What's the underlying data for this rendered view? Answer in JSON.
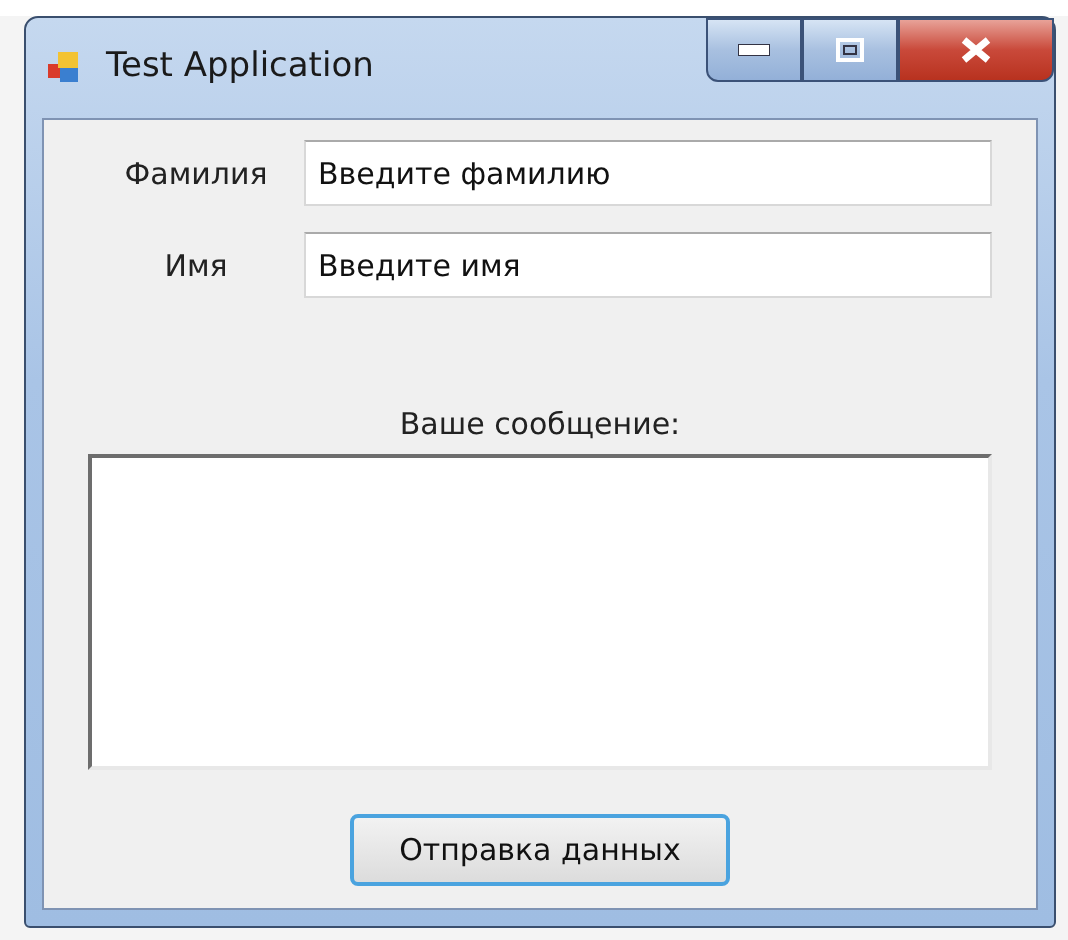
{
  "window": {
    "title": "Test Application"
  },
  "fields": [
    {
      "label": "Фамилия",
      "value": "Введите фамилию"
    },
    {
      "label": "Имя",
      "value": "Введите имя"
    }
  ],
  "message": {
    "label": "Ваше сообщение:"
  },
  "buttons": [
    "Отправка данных"
  ]
}
